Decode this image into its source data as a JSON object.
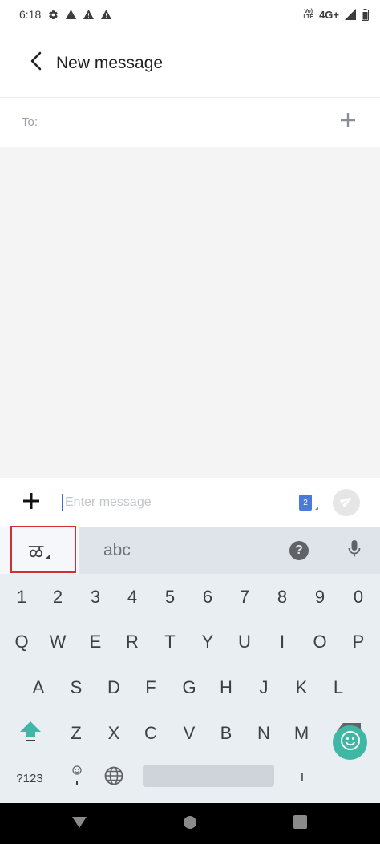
{
  "status_bar": {
    "time": "6:18",
    "volte_line1": "Vo)",
    "volte_line2": "LTE",
    "network": "4G+",
    "icons": [
      "settings-icon",
      "warning-icon",
      "warning-icon",
      "warning-icon",
      "volte-icon",
      "signal-icon",
      "battery-icon"
    ]
  },
  "app_bar": {
    "title": "New message",
    "back_icon": "arrow-back-icon"
  },
  "recipient": {
    "label": "To:",
    "value": "",
    "add_icon": "plus-icon"
  },
  "compose": {
    "placeholder": "Enter message",
    "value": "",
    "sim_label": "2",
    "attach_icon": "plus-icon",
    "send_icon": "send-icon"
  },
  "keyboard": {
    "language_glyph": "ळ",
    "suggestion": "abc",
    "help_label": "?",
    "number_row": [
      "1",
      "2",
      "3",
      "4",
      "5",
      "6",
      "7",
      "8",
      "9",
      "0"
    ],
    "row1": [
      "Q",
      "W",
      "E",
      "R",
      "T",
      "Y",
      "U",
      "I",
      "O",
      "P"
    ],
    "row2": [
      "A",
      "S",
      "D",
      "F",
      "G",
      "H",
      "J",
      "K",
      "L"
    ],
    "row3": [
      "Z",
      "X",
      "C",
      "V",
      "B",
      "N",
      "M"
    ],
    "symbols_label": "?123",
    "period_label": "I",
    "accent_color": "#3fb7a4"
  },
  "colors": {
    "highlight": "#d32f2f",
    "keyboard_bg": "#e9eef3",
    "conversation_bg": "#f4f4f4"
  }
}
